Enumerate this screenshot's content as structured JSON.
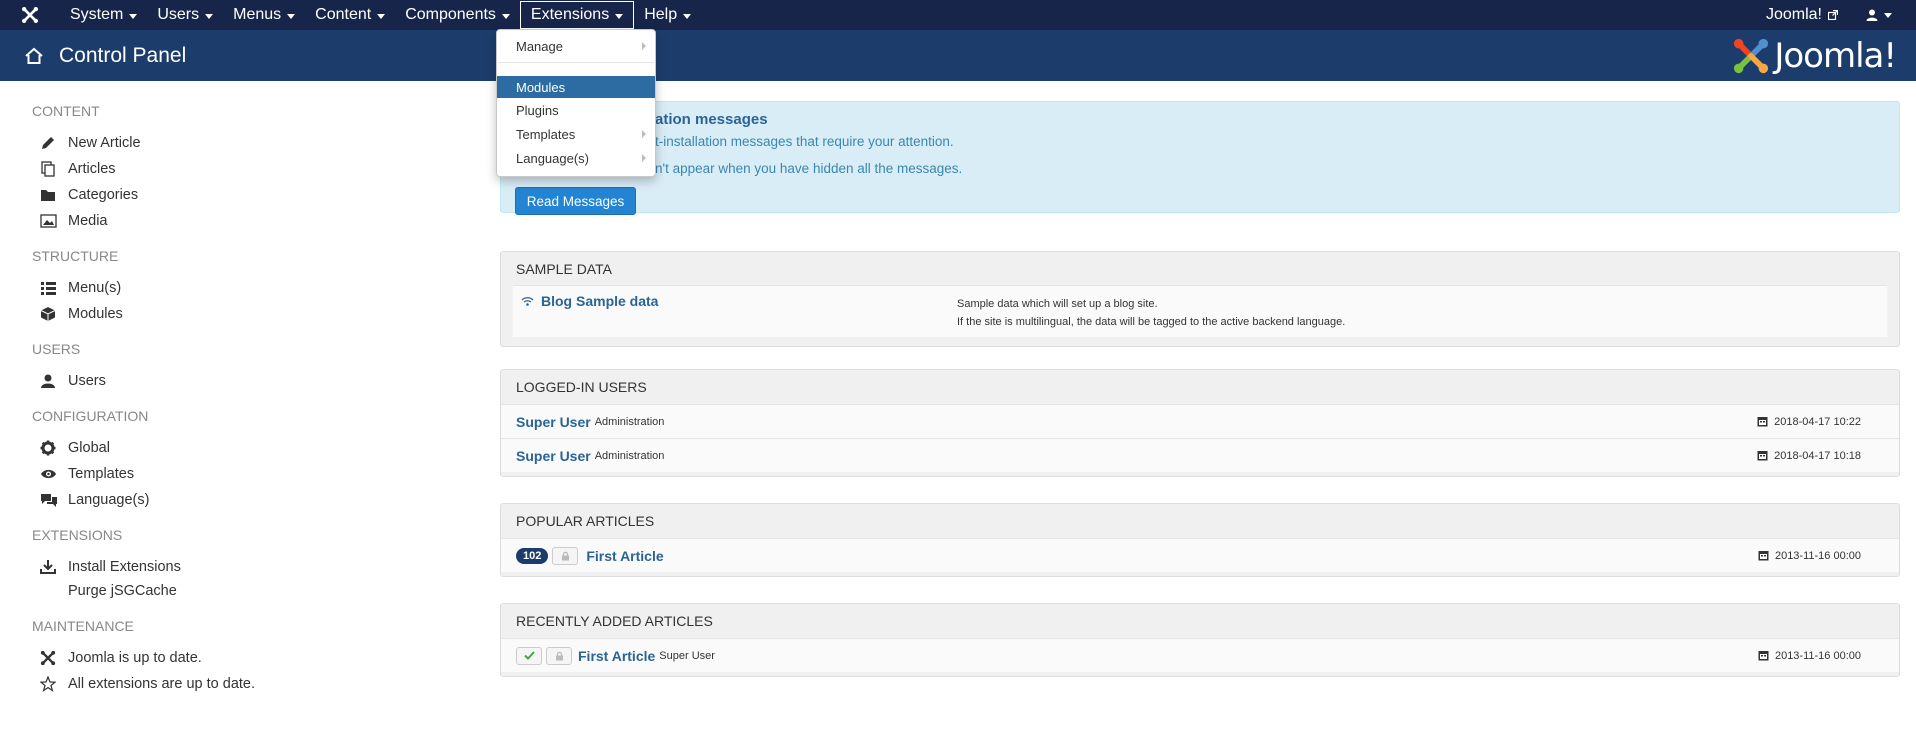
{
  "topnav": {
    "menus": [
      {
        "label": "System"
      },
      {
        "label": "Users"
      },
      {
        "label": "Menus"
      },
      {
        "label": "Content"
      },
      {
        "label": "Components"
      },
      {
        "label": "Extensions"
      },
      {
        "label": "Help"
      }
    ],
    "site_link": "Joomla!",
    "user_icon": "user-icon"
  },
  "header": {
    "title": "Control Panel",
    "brand": "Joomla!"
  },
  "sidebar": {
    "sections": [
      {
        "heading": "CONTENT",
        "items": [
          {
            "label": "New Article",
            "icon": "pencil-icon"
          },
          {
            "label": "Articles",
            "icon": "copy-icon"
          },
          {
            "label": "Categories",
            "icon": "folder-icon"
          },
          {
            "label": "Media",
            "icon": "image-icon"
          }
        ]
      },
      {
        "heading": "STRUCTURE",
        "items": [
          {
            "label": "Menu(s)",
            "icon": "list-icon"
          },
          {
            "label": "Modules",
            "icon": "cube-icon"
          }
        ]
      },
      {
        "heading": "USERS",
        "items": [
          {
            "label": "Users",
            "icon": "users-icon"
          }
        ]
      },
      {
        "heading": "CONFIGURATION",
        "items": [
          {
            "label": "Global",
            "icon": "cog-icon"
          },
          {
            "label": "Templates",
            "icon": "eye-icon"
          },
          {
            "label": "Language(s)",
            "icon": "comments-icon"
          }
        ]
      },
      {
        "heading": "EXTENSIONS",
        "items": [
          {
            "label": "Install Extensions",
            "icon": "download-icon"
          },
          {
            "label": "Purge jSGCache",
            "icon": ""
          }
        ]
      },
      {
        "heading": "MAINTENANCE",
        "items": [
          {
            "label": "Joomla is up to date.",
            "icon": "joomla-icon"
          },
          {
            "label": "All extensions are up to date.",
            "icon": "star-icon"
          }
        ]
      }
    ]
  },
  "messages": {
    "heading": "ation messages",
    "line1": "t-installation messages that require your attention.",
    "line2": "n't appear when you have hidden all the messages.",
    "button": "Read Messages"
  },
  "sample_data": {
    "heading": "SAMPLE DATA",
    "item_title": "Blog Sample data",
    "desc1": "Sample data which will set up a blog site.",
    "desc2": "If the site is multilingual, the data will be tagged to the active backend language."
  },
  "logged_in": {
    "heading": "LOGGED-IN USERS",
    "rows": [
      {
        "name": "Super User",
        "area": "Administration",
        "date": "2018-04-17 10:22"
      },
      {
        "name": "Super User",
        "area": "Administration",
        "date": "2018-04-17 10:18"
      }
    ]
  },
  "popular": {
    "heading": "POPULAR ARTICLES",
    "rows": [
      {
        "hits": "102",
        "title": "First Article",
        "date": "2013-11-16 00:00"
      }
    ]
  },
  "recent": {
    "heading": "RECENTLY ADDED ARTICLES",
    "rows": [
      {
        "title": "First Article",
        "author": "Super User",
        "date": "2013-11-16 00:00"
      }
    ]
  },
  "extensions_menu": {
    "items": [
      {
        "label": "Manage"
      },
      {
        "label": "Modules"
      },
      {
        "label": "Plugins"
      },
      {
        "label": "Templates"
      },
      {
        "label": "Language(s)"
      }
    ]
  },
  "colors": {
    "navbar": "#17254a",
    "header": "#1c3d6b",
    "link": "#2a6496",
    "primary_button": "#2384d3",
    "menu_active": "#2d6ca2"
  }
}
